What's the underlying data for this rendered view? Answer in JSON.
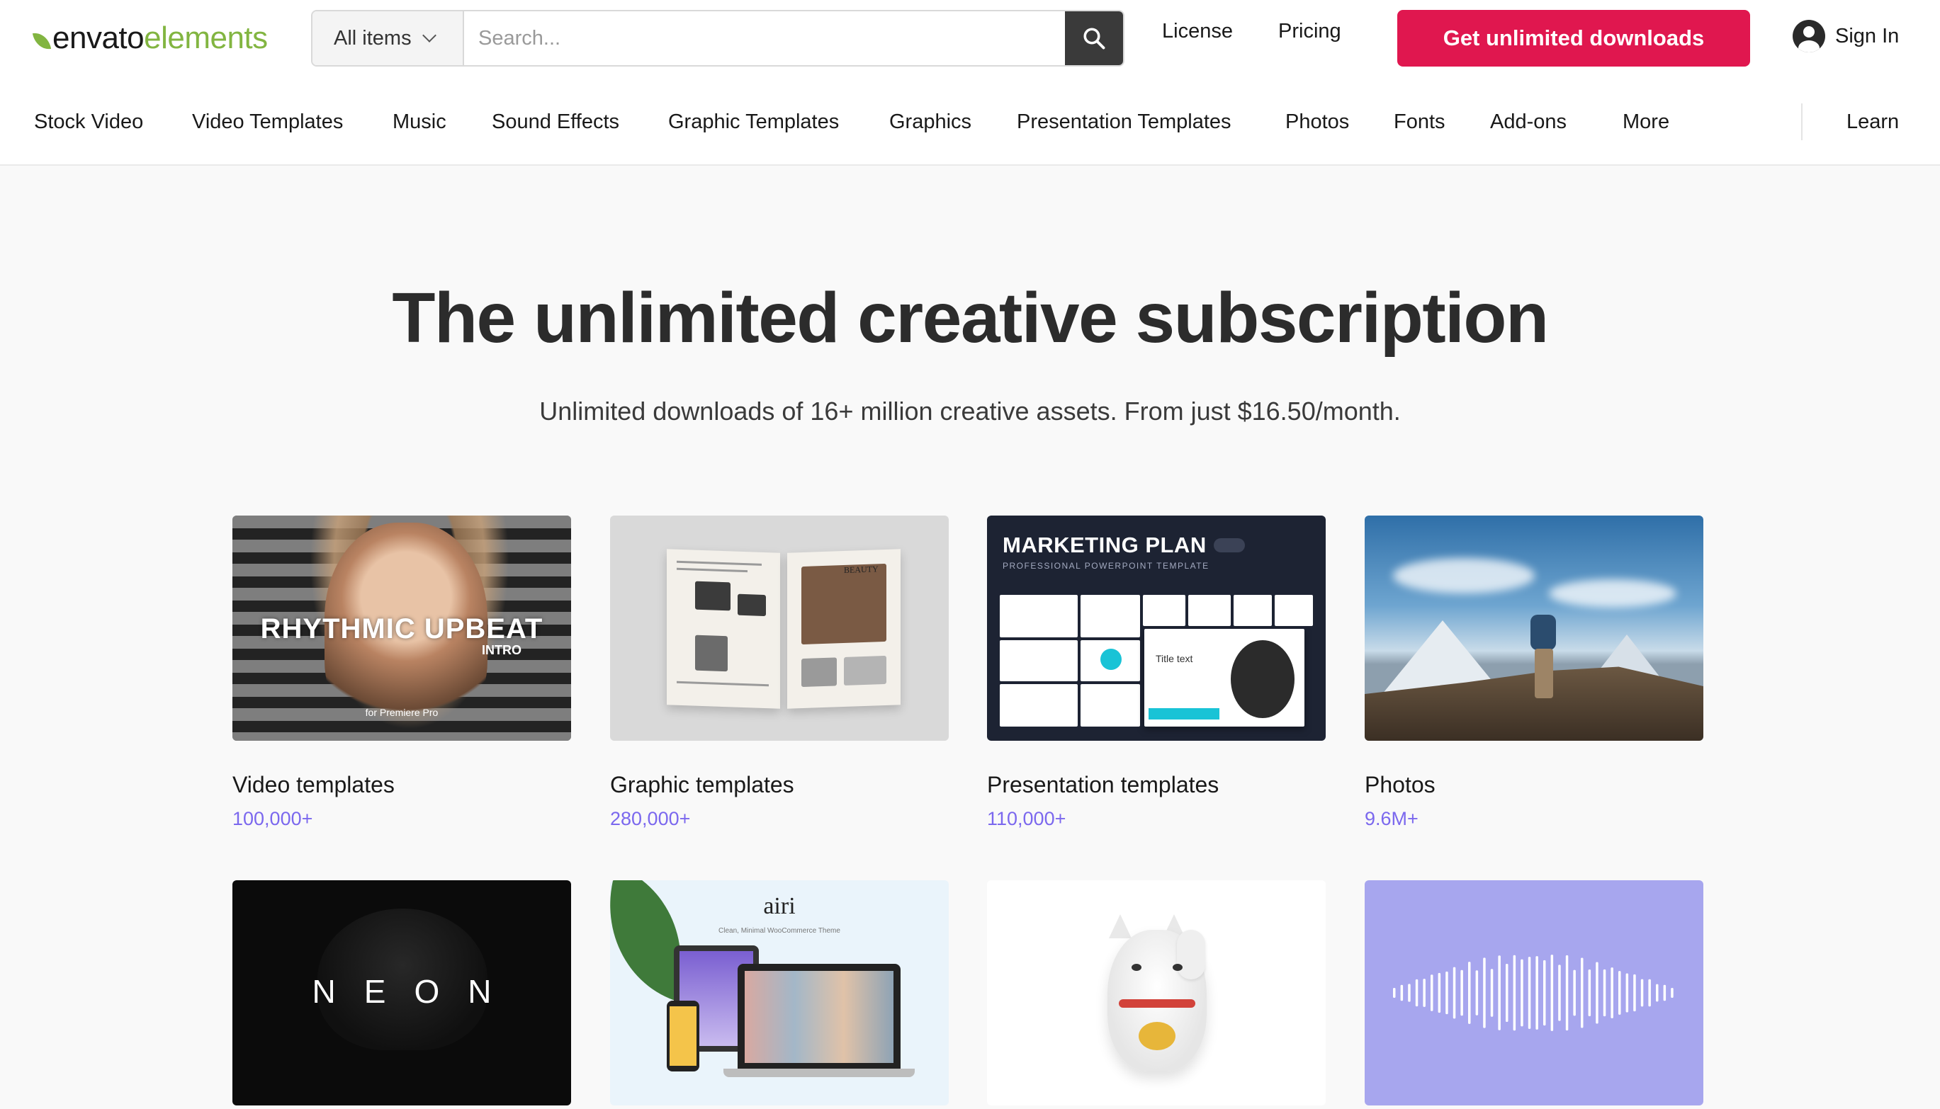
{
  "logo": {
    "part1": "envato",
    "part2": "elements"
  },
  "search": {
    "category": "All items",
    "placeholder": "Search..."
  },
  "header_links": {
    "license": "License",
    "pricing": "Pricing"
  },
  "cta": "Get unlimited downloads",
  "signin": "Sign In",
  "nav": [
    "Stock Video",
    "Video Templates",
    "Music",
    "Sound Effects",
    "Graphic Templates",
    "Graphics",
    "Presentation Templates",
    "Photos",
    "Fonts",
    "Add-ons",
    "More",
    "Learn"
  ],
  "hero": {
    "title": "The unlimited creative subscription",
    "subtitle": "Unlimited downloads of 16+ million creative assets. From just $16.50/month."
  },
  "cards": [
    {
      "title": "Video templates",
      "count": "100,000+",
      "thumb_text": "RHYTHMIC UPBEAT",
      "thumb_sub": "INTRO",
      "thumb_small": "for Premiere Pro"
    },
    {
      "title": "Graphic templates",
      "count": "280,000+",
      "thumb_text": "BEAUTY"
    },
    {
      "title": "Presentation templates",
      "count": "110,000+",
      "thumb_text": "MARKETING PLAN",
      "thumb_sub": "PROFESSIONAL POWERPOINT TEMPLATE",
      "thumb_small": "Title text"
    },
    {
      "title": "Photos",
      "count": "9.6M+"
    }
  ],
  "row2": [
    {
      "thumb_text": "NEON"
    },
    {
      "thumb_text": "airi",
      "thumb_sub": "Clean, Minimal WooCommerce Theme"
    },
    {
      "thumb_text": ""
    },
    {
      "thumb_text": ""
    }
  ],
  "colors": {
    "brand_green": "#82b541",
    "cta_red": "#e0174f",
    "count_purple": "#7b68ee",
    "audio_bg": "#a7a6ee"
  }
}
